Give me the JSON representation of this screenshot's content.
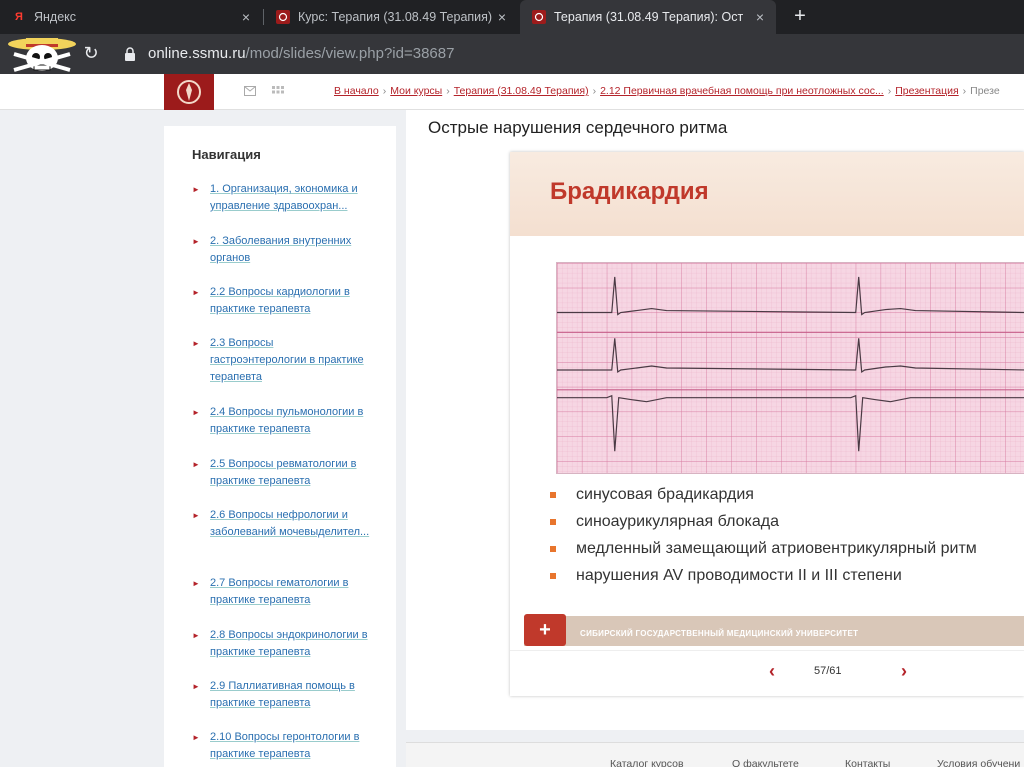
{
  "browser": {
    "tabs": [
      {
        "title": "Яндекс",
        "icon": "yandex-icon"
      },
      {
        "title": "Курс: Терапия (31.08.49 Терапия)",
        "icon": "ssmu-crest-icon"
      },
      {
        "title": "Терапия (31.08.49 Терапия): Ост",
        "icon": "ssmu-crest-icon"
      }
    ],
    "new_tab": "+",
    "close_symbol": "×",
    "url_host": "online.ssmu.ru",
    "url_path": "/mod/slides/view.php?id=38687"
  },
  "breadcrumbs": [
    "В начало",
    "Мои курсы",
    "Терапия (31.08.49 Терапия)",
    "2.12 Первичная врачебная помощь при неотложных сос...",
    "Презентация",
    "Презе"
  ],
  "navigation": {
    "title": "Навигация",
    "items": [
      "1. Организация, экономика и управление здравоохран...",
      "2. Заболевания внутренних органов",
      "2.2 Вопросы кардиологии в практике терапевта",
      "2.3 Вопросы гастроэнтерологии в практике терапевта",
      "2.4 Вопросы пульмонологии в практике терапевта",
      "2.5 Вопросы ревматологии в практике терапевта",
      "2.6 Вопросы нефрологии и заболеваний мочевыделител...",
      "2.7 Вопросы гематологии в практике терапевта",
      "2.8 Вопросы эндокринологии в практике терапевта",
      "2.9 Паллиативная помощь в практике терапевта",
      "2.10 Вопросы геронтологии в практике терапевта"
    ]
  },
  "main": {
    "heading": "Острые нарушения сердечного ритма"
  },
  "slide": {
    "title": "Брадикардия",
    "bullets": [
      "синусовая брадикардия",
      "синоаурикулярная блокада",
      "медленный замещающий атриовентрикулярный ритм",
      "нарушения AV проводимости II и III степени"
    ],
    "university": "СИБИРСКИЙ ГОСУДАРСТВЕННЫЙ МЕДИЦИНСКИЙ УНИВЕРСИТЕТ",
    "page": "57/61",
    "prev": "‹",
    "next": "›"
  },
  "footer": {
    "links": [
      "Каталог курсов",
      "О факультете",
      "Контакты",
      "Условия обучени"
    ]
  },
  "colors": {
    "brand": "#9c1b1b",
    "accent": "#c0392b",
    "link": "#2a6fb0",
    "bullet": "#e8752d"
  }
}
